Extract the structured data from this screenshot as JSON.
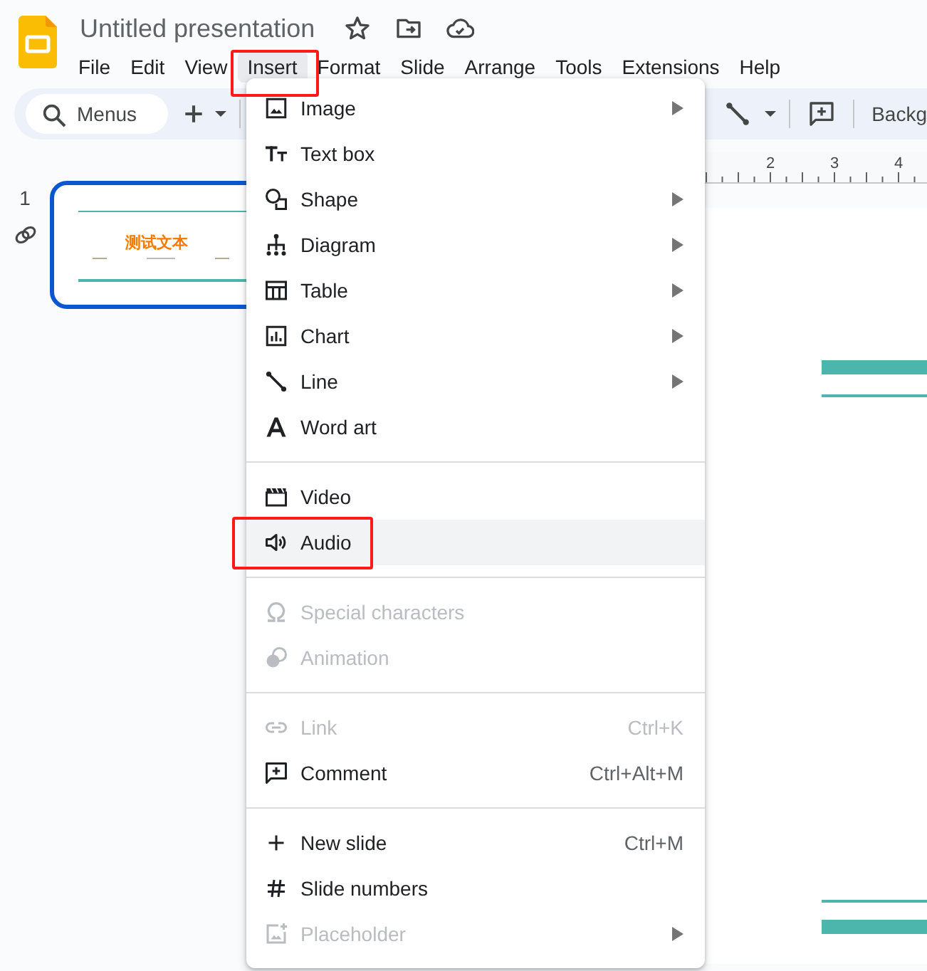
{
  "app": {
    "title": "Untitled presentation"
  },
  "menu_bar": [
    {
      "label": "File",
      "selected": false,
      "annotated": false
    },
    {
      "label": "Edit",
      "selected": false,
      "annotated": false
    },
    {
      "label": "View",
      "selected": false,
      "annotated": false
    },
    {
      "label": "Insert",
      "selected": true,
      "annotated": true
    },
    {
      "label": "Format",
      "selected": false,
      "annotated": false
    },
    {
      "label": "Slide",
      "selected": false,
      "annotated": false
    },
    {
      "label": "Arrange",
      "selected": false,
      "annotated": false
    },
    {
      "label": "Tools",
      "selected": false,
      "annotated": false
    },
    {
      "label": "Extensions",
      "selected": false,
      "annotated": false
    },
    {
      "label": "Help",
      "selected": false,
      "annotated": false
    }
  ],
  "toolbar": {
    "search": {
      "placeholder": "Menus"
    },
    "background_button": "Backg"
  },
  "ruler": {
    "labels": [
      "2",
      "3",
      "4"
    ]
  },
  "slides": [
    {
      "number": "1",
      "selected": true,
      "title": "测试文本"
    }
  ],
  "insert_menu": {
    "sections": [
      [
        {
          "kind": "image",
          "label": "Image",
          "submenu": true,
          "disabled": false,
          "hovered": false,
          "annotated": false
        },
        {
          "kind": "textbox",
          "label": "Text box",
          "submenu": false,
          "disabled": false,
          "hovered": false,
          "annotated": false
        },
        {
          "kind": "shape",
          "label": "Shape",
          "submenu": true,
          "disabled": false,
          "hovered": false,
          "annotated": false
        },
        {
          "kind": "diagram",
          "label": "Diagram",
          "submenu": true,
          "disabled": false,
          "hovered": false,
          "annotated": false
        },
        {
          "kind": "table",
          "label": "Table",
          "submenu": true,
          "disabled": false,
          "hovered": false,
          "annotated": false
        },
        {
          "kind": "chart",
          "label": "Chart",
          "submenu": true,
          "disabled": false,
          "hovered": false,
          "annotated": false
        },
        {
          "kind": "line",
          "label": "Line",
          "submenu": true,
          "disabled": false,
          "hovered": false,
          "annotated": false
        },
        {
          "kind": "wordart",
          "label": "Word art",
          "submenu": false,
          "disabled": false,
          "hovered": false,
          "annotated": false
        }
      ],
      [
        {
          "kind": "video",
          "label": "Video",
          "submenu": false,
          "disabled": false,
          "hovered": false,
          "annotated": false
        },
        {
          "kind": "audio",
          "label": "Audio",
          "submenu": false,
          "disabled": false,
          "hovered": true,
          "annotated": true
        }
      ],
      [
        {
          "kind": "omega",
          "label": "Special characters",
          "submenu": false,
          "disabled": true,
          "hovered": false,
          "annotated": false
        },
        {
          "kind": "animation",
          "label": "Animation",
          "submenu": false,
          "disabled": true,
          "hovered": false,
          "annotated": false
        }
      ],
      [
        {
          "kind": "link",
          "label": "Link",
          "shortcut": "Ctrl+K",
          "submenu": false,
          "disabled": true,
          "hovered": false,
          "annotated": false
        },
        {
          "kind": "comment",
          "label": "Comment",
          "shortcut": "Ctrl+Alt+M",
          "submenu": false,
          "disabled": false,
          "hovered": false,
          "annotated": false
        }
      ],
      [
        {
          "kind": "plus",
          "label": "New slide",
          "shortcut": "Ctrl+M",
          "submenu": false,
          "disabled": false,
          "hovered": false,
          "annotated": false
        },
        {
          "kind": "hash",
          "label": "Slide numbers",
          "submenu": false,
          "disabled": false,
          "hovered": false,
          "annotated": false
        },
        {
          "kind": "placeholder",
          "label": "Placeholder",
          "submenu": true,
          "disabled": true,
          "hovered": false,
          "annotated": false
        }
      ]
    ]
  }
}
